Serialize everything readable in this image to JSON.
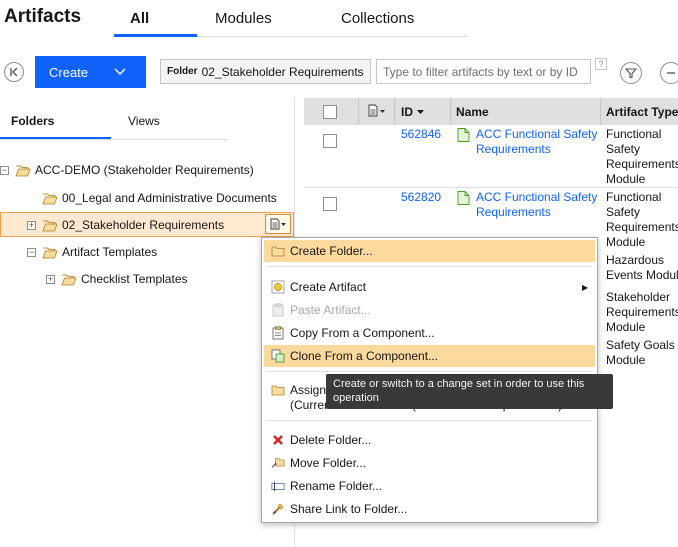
{
  "app": {
    "title": "Artifacts"
  },
  "top_tabs": [
    {
      "label": "All",
      "active": true
    },
    {
      "label": "Modules",
      "active": false
    },
    {
      "label": "Collections",
      "active": false
    }
  ],
  "toolbar": {
    "create_label": "Create",
    "folder_key": "Folder",
    "folder_value": "02_Stakeholder Requirements",
    "filter_placeholder": "Type to filter artifacts by text or by ID",
    "help_glyph": "?"
  },
  "left_tabs": [
    {
      "label": "Folders",
      "active": true
    },
    {
      "label": "Views",
      "active": false
    }
  ],
  "tree": [
    {
      "label": "ACC-DEMO (Stakeholder Requirements)",
      "expander": "−"
    },
    {
      "label": "00_Legal and Administrative Documents",
      "expander": ""
    },
    {
      "label": "02_Stakeholder Requirements",
      "expander": "+"
    },
    {
      "label": "Artifact Templates",
      "expander": "−"
    },
    {
      "label": "Checklist Templates",
      "expander": "+"
    }
  ],
  "table": {
    "headers": {
      "id": "ID",
      "name": "Name",
      "type": "Artifact Type"
    },
    "rows": [
      {
        "id": "562846",
        "name_lines": [
          "ACC Functional Safety",
          "Requirements"
        ],
        "type_lines": [
          "Functional",
          "Safety",
          "Requirements",
          "Module"
        ]
      },
      {
        "id": "562820",
        "name_lines": [
          "ACC Functional Safety",
          "Requirements"
        ],
        "type_lines": [
          "Functional",
          "Safety",
          "Requirements",
          "Module"
        ]
      }
    ],
    "extra_types": [
      [
        "Hazardous",
        "Events Module"
      ],
      [
        "Stakeholder",
        "Requirements",
        "Module"
      ],
      [
        "Safety Goals",
        "Module"
      ]
    ]
  },
  "context_menu": {
    "items": [
      {
        "label": "Create Folder...",
        "icon": "folder-new-icon",
        "highlighted": true,
        "disabled": false
      },
      {
        "label": "Create Artifact",
        "icon": "artifact-new-icon",
        "highlighted": false,
        "disabled": false,
        "submenu_glyph": "▶"
      },
      {
        "label": "Paste Artifact...",
        "icon": "paste-icon",
        "highlighted": false,
        "disabled": true
      },
      {
        "label": "Copy From a Component...",
        "icon": "copy-icon",
        "highlighted": false,
        "disabled": false
      },
      {
        "label": "Clone From a Component...",
        "icon": "clone-icon",
        "highlighted": true,
        "disabled": false
      },
      {
        "label_line1": "Assign",
        "label_line2": "(Curren",
        "label_line2_tail": "(Stakeholder Requirements)...",
        "icon": "assign-folder-icon"
      },
      {
        "label": "Delete Folder...",
        "icon": "delete-icon",
        "highlighted": false,
        "disabled": false
      },
      {
        "label": "Move Folder...",
        "icon": "move-icon",
        "highlighted": false,
        "disabled": false
      },
      {
        "label": "Rename Folder...",
        "icon": "rename-icon",
        "highlighted": false,
        "disabled": false
      },
      {
        "label": "Share Link to Folder...",
        "icon": "share-link-icon",
        "highlighted": false,
        "disabled": false
      }
    ],
    "tooltip": "Create or switch to a change set in order to use this operation"
  },
  "colors": {
    "accent": "#0f62fe",
    "selected_row_bg": "#ffe9d1",
    "selected_row_border": "#f1a44b",
    "menu_highlight": "#fcd99d",
    "tooltip_bg": "#393939"
  }
}
